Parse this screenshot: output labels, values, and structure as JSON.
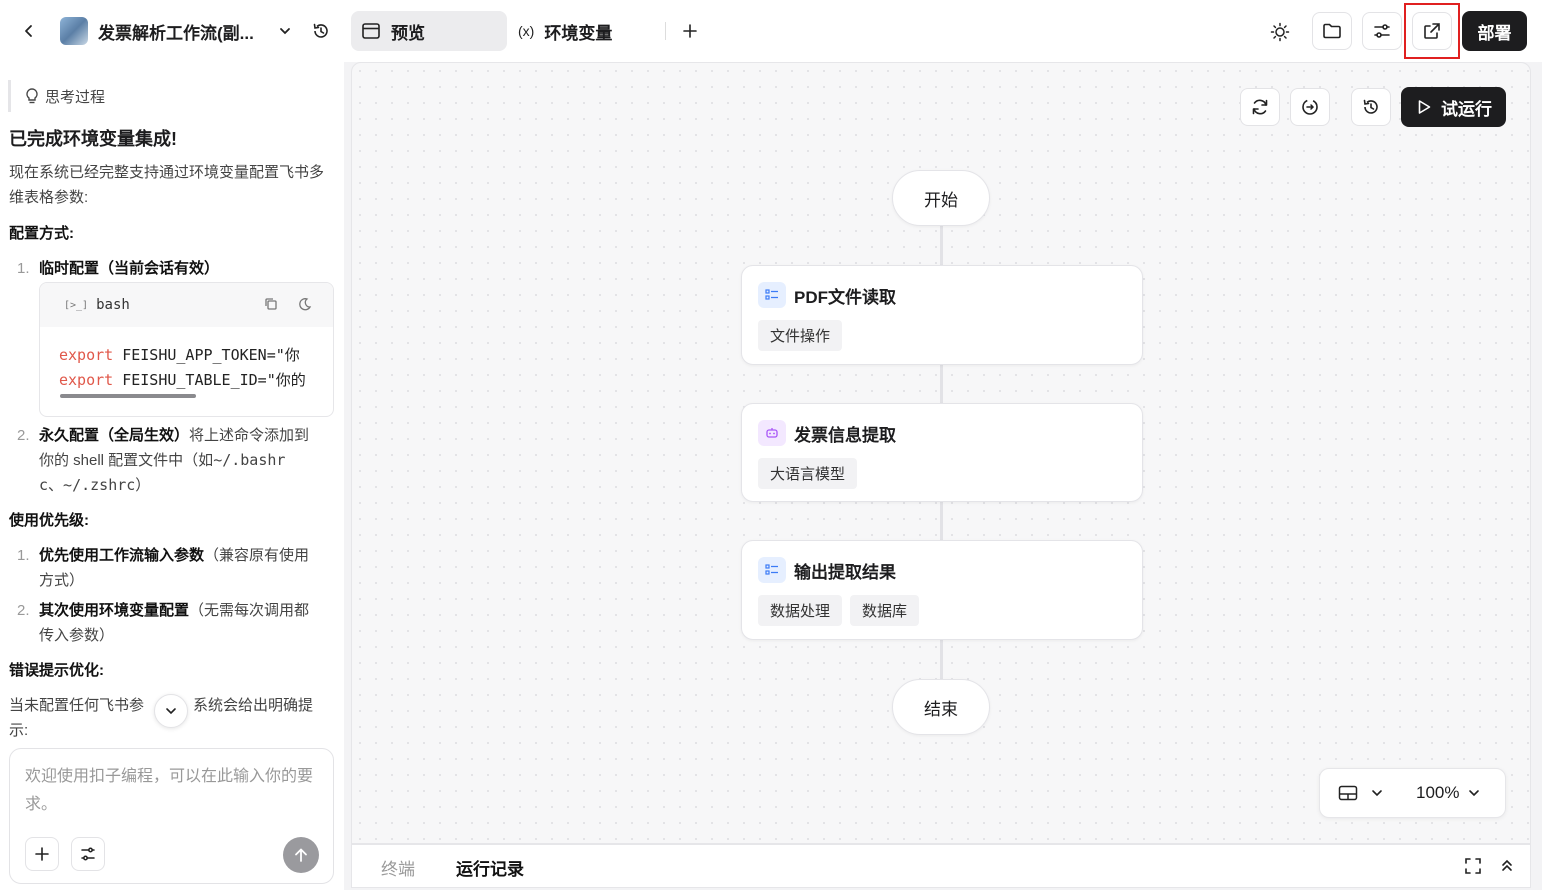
{
  "header": {
    "back_label": "<",
    "project_title": "发票解析工作流(副...",
    "tabs": [
      {
        "label": "预览",
        "active": true
      },
      {
        "label": "环境变量",
        "active": false
      }
    ],
    "deploy_label": "部署"
  },
  "sidebar": {
    "thinking_label": "思考过程",
    "heading": "已完成环境变量集成!",
    "intro": "现在系统已经完整支持通过环境变量配置飞书多维表格参数:",
    "config_title": "配置方式:",
    "config_items": [
      {
        "num": "1.",
        "bold": "临时配置（当前会话有效）"
      },
      {
        "num": "2.",
        "bold": "永久配置（全局生效）",
        "rest_1": "将上述命令添加到",
        "rest_2": "你的 shell 配置文件中（如",
        "code_1": "~/.bashr",
        "code_2": "c",
        "sep": "、",
        "code_3": "~/.zshrc",
        "close": "）"
      }
    ],
    "code_block": {
      "lang": "bash",
      "line1_kw": "export",
      "line1_rest": " FEISHU_APP_TOKEN=\"你",
      "line2_kw": "export",
      "line2_rest": " FEISHU_TABLE_ID=\"你的"
    },
    "priority_title": "使用优先级:",
    "priority_items": [
      {
        "num": "1.",
        "bold": "优先使用工作流输入参数",
        "rest_1": "（兼容原有使用",
        "rest_2": "方式）"
      },
      {
        "num": "2.",
        "bold": "其次使用环境变量配置",
        "rest_1": "（无需每次调用都",
        "rest_2": "传入参数）"
      }
    ],
    "error_title": "错误提示优化:",
    "error_text_1": "当未配置任何飞书参",
    "error_text_2": "，系统会给出明确提",
    "error_text_3": "示:",
    "input_placeholder": "欢迎使用扣子编程，可以在此输入你的要求。"
  },
  "canvas": {
    "run_label": "试运行",
    "start_label": "开始",
    "end_label": "结束",
    "nodes": [
      {
        "title": "PDF文件读取",
        "tags": [
          "文件操作"
        ],
        "icon": "list-icon",
        "color": "#3b7bf6"
      },
      {
        "title": "发票信息提取",
        "tags": [
          "大语言模型"
        ],
        "icon": "robot-icon",
        "color": "#a855f7"
      },
      {
        "title": "输出提取结果",
        "tags": [
          "数据处理",
          "数据库"
        ],
        "icon": "list-icon",
        "color": "#3b7bf6"
      }
    ],
    "zoom": "100%"
  },
  "bottom": {
    "tabs": [
      {
        "label": "终端",
        "active": false
      },
      {
        "label": "运行记录",
        "active": true
      }
    ]
  },
  "colors": {
    "dark_button": "#1d1d1f",
    "highlight": "#e02020",
    "code_keyword": "#e0584a",
    "code_string": "#2f9a3e"
  }
}
